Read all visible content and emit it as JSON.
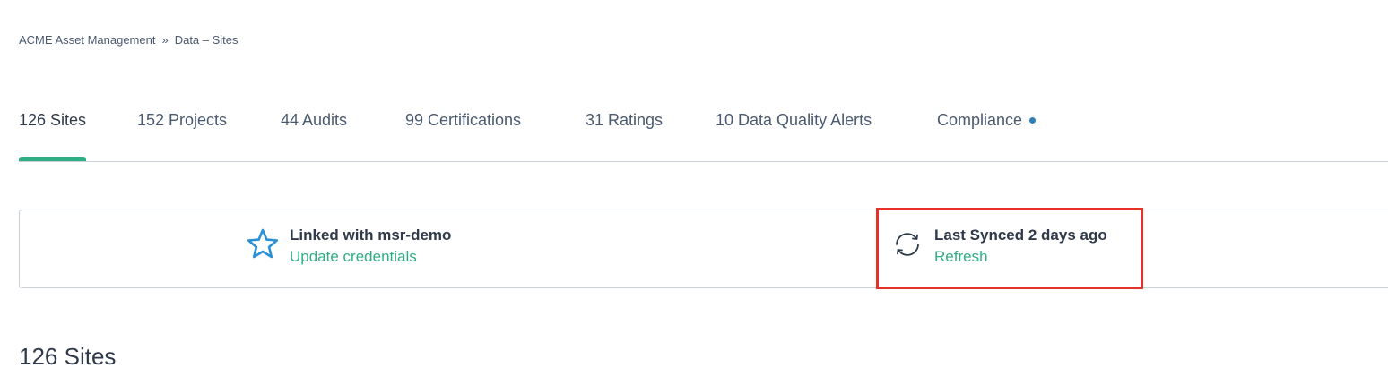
{
  "breadcrumb": {
    "org": "ACME Asset Management",
    "separator": "»",
    "current": "Data – Sites"
  },
  "tabs": [
    {
      "label": "126 Sites",
      "active": true
    },
    {
      "label": "152 Projects",
      "active": false
    },
    {
      "label": "44 Audits",
      "active": false
    },
    {
      "label": "99 Certifications",
      "active": false
    },
    {
      "label": "31 Ratings",
      "active": false
    },
    {
      "label": "10 Data Quality Alerts",
      "active": false
    },
    {
      "label": "Compliance",
      "active": false,
      "has_dot": true
    }
  ],
  "status": {
    "linked": {
      "icon": "star-icon",
      "title": "Linked with msr-demo",
      "link": "Update credentials"
    },
    "sync": {
      "icon": "sync-icon",
      "title": "Last Synced 2 days ago",
      "link": "Refresh"
    }
  },
  "section": {
    "title": "126 Sites"
  },
  "colors": {
    "accent": "#2fae84",
    "dot": "#2e7fb8",
    "star": "#2b8fd6",
    "highlight": "#e5312a",
    "text": "#2f3a4a",
    "muted": "#4a5a70"
  }
}
